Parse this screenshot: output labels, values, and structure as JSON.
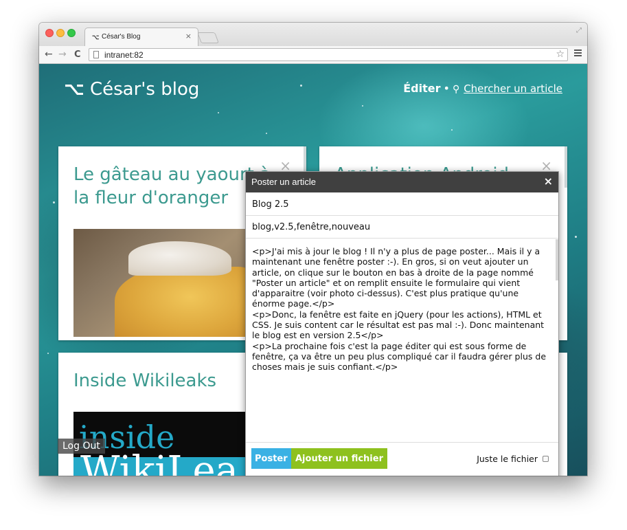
{
  "browser": {
    "tab_title": "César's Blog",
    "tab_favicon": "⌥",
    "tab_close": "×",
    "url": "intranet:82",
    "back": "←",
    "forward": "→",
    "reload": "C",
    "star": "☆"
  },
  "site": {
    "logo_symbol": "⌥",
    "title": "César's blog",
    "nav_edit": "Éditer",
    "nav_sep": "•",
    "search_icon": "search-icon",
    "search_label": "Chercher un article",
    "logout": "Log Out"
  },
  "articles": [
    {
      "title": "Le gâteau au yaourt à la fleur d'oranger",
      "close": "×"
    },
    {
      "title": "Application Android",
      "close": "×"
    },
    {
      "title": "Inside Wikileaks",
      "image_text_1": "inside",
      "image_text_2": "WikiLea"
    }
  ],
  "dialog": {
    "title": "Poster un article",
    "close": "×",
    "title_value": "Blog 2.5",
    "tags_value": "blog,v2.5,fenêtre,nouveau",
    "content_value": "<p>J'ai mis à jour le blog ! Il n'y a plus de page poster... Mais il y a maintenant une fenêtre poster :-). En gros, si on veut ajouter un article, on clique sur le bouton en bas à droite de la page nommé \"Poster un article\" et on remplit ensuite le formulaire qui vient d'apparaitre (voir photo ci-dessus). C'est plus pratique qu'une énorme page.</p>\n<p>Donc, la fenêtre est faite en jQuery (pour les actions), HTML et CSS. Je suis content car le résultat est pas mal :-). Donc maintenant le blog est en version 2.5</p>\n<p>La prochaine fois c'est la page éditer qui est sous forme de fenêtre, ça va être un peu plus compliqué car il faudra gérer plus de choses mais je suis confiant.</p>",
    "btn_poster": "Poster",
    "btn_file": "Ajouter un fichier",
    "only_file_label": "Juste le fichier",
    "only_file_checked": false
  },
  "colors": {
    "accent_teal": "#3c9a8f",
    "poster_blue": "#3ab1e4",
    "file_green": "#8ec11e",
    "dialog_header": "#404040"
  }
}
